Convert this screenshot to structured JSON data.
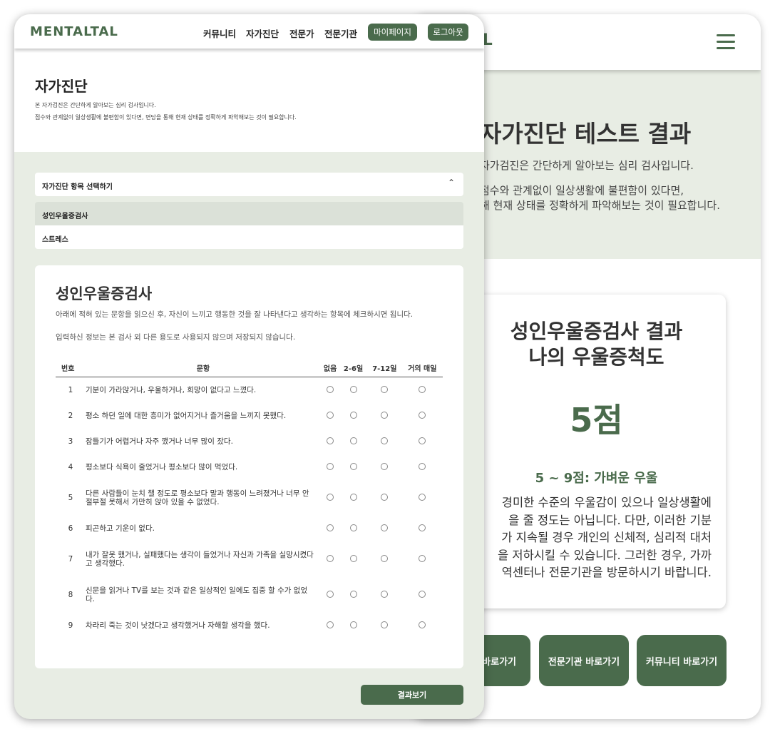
{
  "mobile": {
    "logo": "ALTAL",
    "hero": {
      "title": "자가진단 테스트 결과",
      "desc1": "자가검진은 간단하게 알아보는 심리 검사입니다.",
      "desc2": "점수와 관계없이 일상생활에 불편함이 있다면,",
      "desc3": "해 현재 상태를 정확하게 파악해보는 것이 필요합니다."
    },
    "result": {
      "title_line1": "성인우울증검사 결과",
      "title_line2": "나의 우울증척도",
      "score": "5점",
      "range": "5 ~ 9점: 가벼운 우울",
      "description": "경미한 수준의 우울감이 있으나 일상생활에\n을 줄 정도는 아닙니다. 다만, 이러한 기분\n가 지속될 경우 개인의 신체적, 심리적 대처\n을 저하시킬 수 있습니다. 그러한 경우, 가까\n역센터나 전문기관을 방문하시기 바랍니다."
    },
    "buttons": {
      "b1": "바로가기",
      "b2": "전문기관 바로가기",
      "b3": "커뮤니티 바로가기"
    }
  },
  "desktop": {
    "logo": "MENTALTAL",
    "nav": {
      "community": "커뮤니티",
      "self_test": "자가진단",
      "experts": "전문가",
      "institutions": "전문기관",
      "mypage": "마이페이지",
      "logout": "로그아웃"
    },
    "intro": {
      "title": "자가진단",
      "desc1": "본 자가검진은 간단하게 알아보는 심리 검사입니다.",
      "desc2": "점수와 관계없이 일상생활에 불편함이 있다면, 면담을 통해 현재 상태를 정확하게 파악해보는 것이 필요합니다."
    },
    "select": {
      "label": "자가진단 항목 선택하기",
      "options": [
        "성인우울증검사",
        "스트레스"
      ]
    },
    "test": {
      "title": "성인우울증검사",
      "desc1": "아래에 적혀 있는 문항을 읽으신 후, 자신이 느끼고 행동한 것을 잘 나타낸다고 생각하는 항목에 체크하시면 됩니다.",
      "desc2": "입력하신 정보는 본 검사 외 다른 용도로 사용되지 않으며 저장되지 않습니다.",
      "headers": {
        "num": "번호",
        "question": "문항",
        "c1": "없음",
        "c2": "2-6일",
        "c3": "7-12일",
        "c4": "거의 매일"
      },
      "rows": [
        {
          "num": "1",
          "q": "기분이 가라앉거나, 우울하거나, 희망이 없다고 느꼈다."
        },
        {
          "num": "2",
          "q": "평소 하던 일에 대한 흥미가 없어지거나 즐거움을 느끼지 못했다."
        },
        {
          "num": "3",
          "q": "잠들기가 어렵거나 자주 깼거나 너무 많이 잤다."
        },
        {
          "num": "4",
          "q": "평소보다 식욕이 줄었거나 평소보다 많이 먹었다."
        },
        {
          "num": "5",
          "q": "다른 사람들이 눈치 챌 정도로 평소보다 말과 행동이 느려졌거나 너무 안절부절 못해서 가만히 앉아 있을 수 없었다."
        },
        {
          "num": "6",
          "q": "피곤하고 기운이 없다."
        },
        {
          "num": "7",
          "q": "내가 잘못 했거나, 실패했다는 생각이 들었거나 자신과 가족을 실망시켰다고 생각했다."
        },
        {
          "num": "8",
          "q": "신문을 읽거나 TV를 보는 것과 같은 일상적인 일에도 집중 할 수가 없었다."
        },
        {
          "num": "9",
          "q": "차라리 죽는 것이 낫겠다고 생각했거나 자해할 생각을 했다."
        }
      ]
    },
    "result_button": "결과보기"
  },
  "colors": {
    "accent": "#4a6b4c",
    "background": "#e8ede4",
    "selected_option": "#dbe1d8"
  }
}
